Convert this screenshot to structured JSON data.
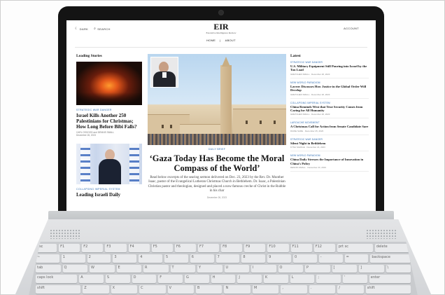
{
  "site": {
    "logo": "EIR",
    "subtitle": "Executive Intelligence Review",
    "top_left": {
      "dark": "DARK",
      "search": "SEARCH"
    },
    "account": "ACCOUNT",
    "nav": [
      "HOME",
      "|",
      "ABOUT"
    ]
  },
  "leading": {
    "title": "Leading Stories",
    "items": [
      {
        "kicker": "STRATEGIC WAR DANGER",
        "headline": "Israel Kills Another 250 Palestinians for Christmas; How Long Before Bibi Falls?",
        "byline": "CARL OSGOOD and DENNIS SMALL",
        "date": "December 26, 2023"
      },
      {
        "kicker": "COLLAPSING IMPERIAL SYSTEM",
        "headline": "Leading Israeli Daily"
      }
    ]
  },
  "featured": {
    "kicker": "DAILY BRIEF",
    "headline": "‘Gaza Today Has Become the Moral Compass of the World’",
    "excerpt": "Read below excerpts of the searing sermon delivered on Dec. 23, 2023 by the Rev. Dr. Munther Isaac, pastor of the Evangelical Lutheran Christmas Church in Bethlehem. Dr. Isaac, a Palestinian Christian pastor and theologian, designed and placed a now-famous creche of Christ in the Rubble in his char",
    "date": "December 26, 2023"
  },
  "latest": {
    "title": "Latest",
    "items": [
      {
        "kicker": "STRATEGIC WAR DANGER",
        "title": "U.S. Military Equipment Still Pouring into Israel by the Ton Load",
        "meta": "GRETCHEN SMALL · December 26, 2023"
      },
      {
        "kicker": "NEW WORLD PARADIGM",
        "title": "Lavrov Discusses How Justice in the Global Order Will Develop",
        "meta": "GRETCHEN SMALL · December 26, 2023"
      },
      {
        "kicker": "COLLAPSING IMPERIAL SYSTEM",
        "title": "China Reminds West that True Security Comes from Caring for All Humanity",
        "meta": "GRETCHEN SMALL · December 26, 2023"
      },
      {
        "kicker": "LAROUCHE MOVEMENT",
        "title": "A Christmas Call for Action from Senate Candidate Sare",
        "meta": "DIANE SARE · December 25, 2023"
      },
      {
        "kicker": "STRATEGIC WAR DANGER",
        "title": "Silent Night in Bethlehem",
        "meta": "KYNA SAVAGE · December 24, 2023"
      },
      {
        "kicker": "NEW WORLD PARADIGM",
        "title": "China Daily Stresses the Importance of Innovation in China's Policy",
        "meta": "DENNIS SMALL · December 23, 2023"
      }
    ]
  },
  "keyboard": {
    "rows": [
      [
        "esc",
        "F1",
        "F2",
        "F3",
        "F4",
        "F5",
        "F6",
        "F7",
        "F8",
        "F9",
        "F10",
        "F11",
        "F12",
        "prt sc",
        "delete"
      ],
      [
        "~",
        "1",
        "2",
        "3",
        "4",
        "5",
        "6",
        "7",
        "8",
        "9",
        "0",
        "-",
        "=",
        "backspace"
      ],
      [
        "tab",
        "Q",
        "W",
        "E",
        "R",
        "T",
        "Y",
        "U",
        "I",
        "O",
        "P",
        "[",
        "]",
        "\\"
      ],
      [
        "caps lock",
        "A",
        "S",
        "D",
        "F",
        "G",
        "H",
        "J",
        "K",
        "L",
        ";",
        "'",
        "enter"
      ],
      [
        "shift",
        "Z",
        "X",
        "C",
        "V",
        "B",
        "N",
        "M",
        ",",
        ".",
        "/",
        "shift"
      ]
    ]
  }
}
